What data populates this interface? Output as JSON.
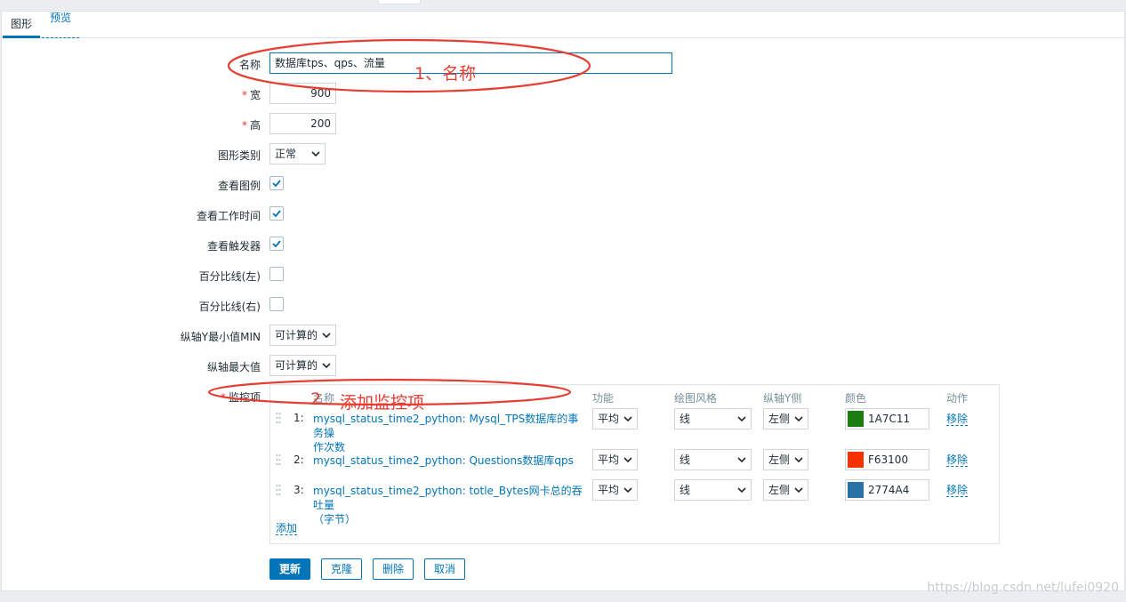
{
  "tabs": [
    {
      "label": "图形"
    },
    {
      "label": "预览"
    }
  ],
  "form": {
    "name_label": "名称",
    "name_value": "数据库tps、qps、流量",
    "width_label": "宽",
    "width_value": "900",
    "height_label": "高",
    "height_value": "200",
    "graph_type_label": "图形类别",
    "graph_type_value": "正常",
    "show_legend_label": "查看图例",
    "show_worktime_label": "查看工作时间",
    "show_triggers_label": "查看触发器",
    "percentile_left_label": "百分比线(左)",
    "percentile_right_label": "百分比线(右)",
    "ymin_label": "纵轴Y最小值MIN",
    "ymin_value": "可计算的",
    "ymax_label": "纵轴最大值",
    "ymax_value": "可计算的",
    "items_label": "监控项",
    "required_mark": "*"
  },
  "checkboxes": {
    "show_legend": true,
    "show_worktime": true,
    "show_triggers": true,
    "percentile_left": false,
    "percentile_right": false
  },
  "items_table": {
    "headers": {
      "name": "名称",
      "function": "功能",
      "draw_style": "绘图风格",
      "y_axis_side": "纵轴Y侧",
      "color": "颜色",
      "action": "动作"
    },
    "rows": [
      {
        "num": "1:",
        "name_line1": "mysql_status_time2_python: Mysql_TPS数据库的事务操",
        "name_line2": "作次数",
        "function": "平均",
        "draw_style": "线",
        "y_side": "左侧",
        "color": "1A7C11",
        "color_hex": "#1A7C11",
        "action": "移除"
      },
      {
        "num": "2:",
        "name_line1": "mysql_status_time2_python: Questions数据库qps",
        "name_line2": "",
        "function": "平均",
        "draw_style": "线",
        "y_side": "左侧",
        "color": "F63100",
        "color_hex": "#F63100",
        "action": "移除"
      },
      {
        "num": "3:",
        "name_line1": "mysql_status_time2_python: totle_Bytes网卡总的吞吐量",
        "name_line2": "（字节）",
        "function": "平均",
        "draw_style": "线",
        "y_side": "左侧",
        "color": "2774A4",
        "color_hex": "#2774A4",
        "action": "移除"
      }
    ],
    "add_label": "添加"
  },
  "buttons": {
    "update": "更新",
    "clone": "克隆",
    "delete": "删除",
    "cancel": "取消"
  },
  "annotations": {
    "note1": "1、名称",
    "note2_num": "2",
    "note2": "添加监控项",
    "color": "#E53F33"
  },
  "watermark": "https://blog.csdn.net/lufei0920",
  "colors": {
    "accent": "#0275B8",
    "required": "#E33734"
  }
}
